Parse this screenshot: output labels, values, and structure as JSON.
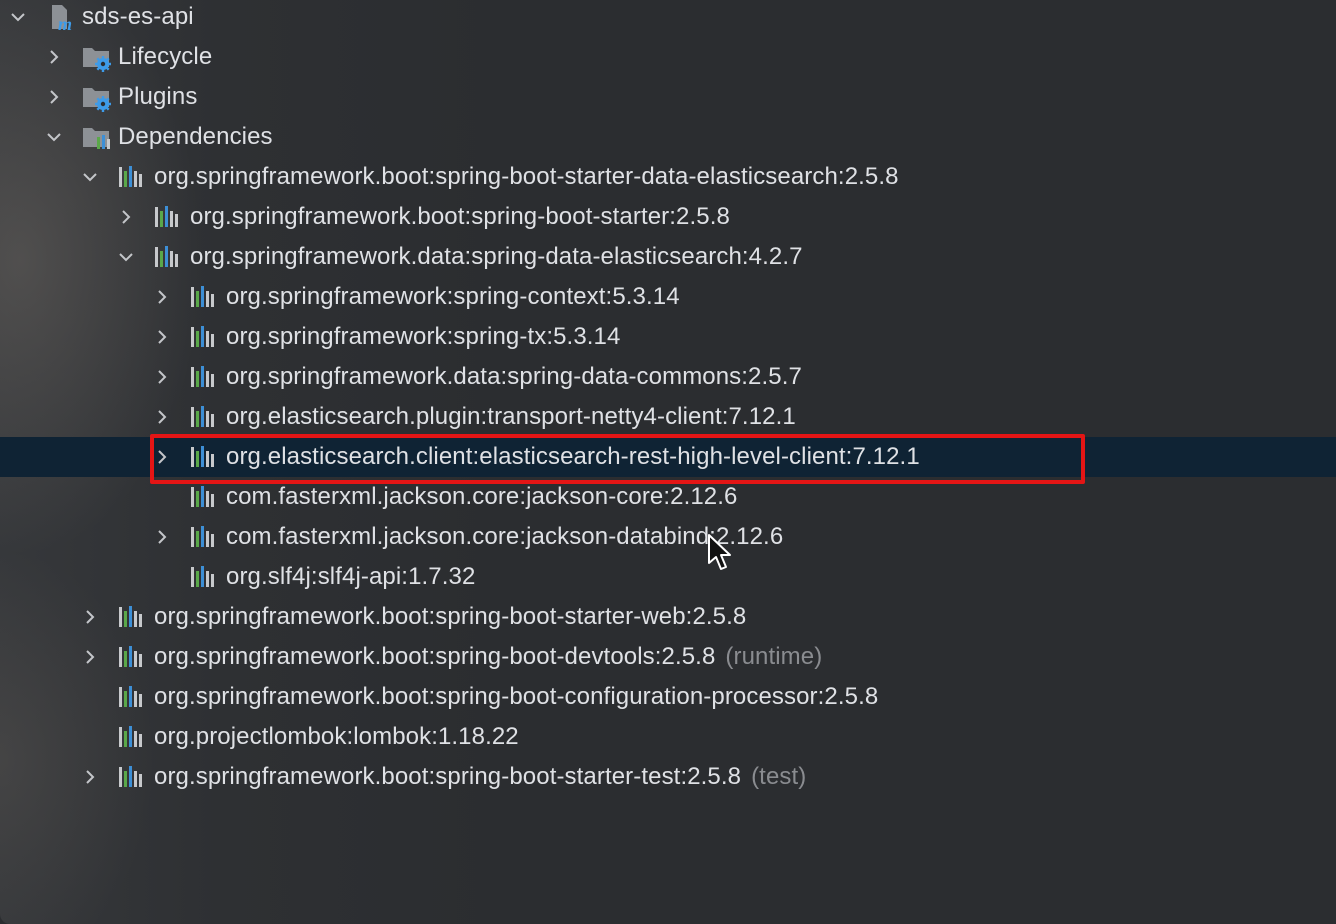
{
  "tree": {
    "project": {
      "name": "sds-es-api",
      "icon": "maven-module-icon"
    },
    "lifecycle": {
      "label": "Lifecycle",
      "icon": "folder-gear-icon"
    },
    "plugins": {
      "label": "Plugins",
      "icon": "folder-gear-icon"
    },
    "dependencies": {
      "label": "Dependencies",
      "icon": "folder-library-icon"
    },
    "items": [
      {
        "label": "org.springframework.boot:spring-boot-starter-data-elasticsearch:2.5.8",
        "scope": "",
        "depth": 1,
        "state": "expanded"
      },
      {
        "label": "org.springframework.boot:spring-boot-starter:2.5.8",
        "scope": "",
        "depth": 2,
        "state": "collapsed"
      },
      {
        "label": "org.springframework.data:spring-data-elasticsearch:4.2.7",
        "scope": "",
        "depth": 2,
        "state": "expanded"
      },
      {
        "label": "org.springframework:spring-context:5.3.14",
        "scope": "",
        "depth": 3,
        "state": "collapsed"
      },
      {
        "label": "org.springframework:spring-tx:5.3.14",
        "scope": "",
        "depth": 3,
        "state": "collapsed"
      },
      {
        "label": "org.springframework.data:spring-data-commons:2.5.7",
        "scope": "",
        "depth": 3,
        "state": "collapsed"
      },
      {
        "label": "org.elasticsearch.plugin:transport-netty4-client:7.12.1",
        "scope": "",
        "depth": 3,
        "state": "collapsed"
      },
      {
        "label": "org.elasticsearch.client:elasticsearch-rest-high-level-client:7.12.1",
        "scope": "",
        "depth": 3,
        "state": "collapsed",
        "selected": true,
        "highlighted": true
      },
      {
        "label": "com.fasterxml.jackson.core:jackson-core:2.12.6",
        "scope": "",
        "depth": 3,
        "state": "leaf"
      },
      {
        "label": "com.fasterxml.jackson.core:jackson-databind:2.12.6",
        "scope": "",
        "depth": 3,
        "state": "collapsed"
      },
      {
        "label": "org.slf4j:slf4j-api:1.7.32",
        "scope": "",
        "depth": 3,
        "state": "leaf"
      },
      {
        "label": "org.springframework.boot:spring-boot-starter-web:2.5.8",
        "scope": "",
        "depth": 1,
        "state": "collapsed"
      },
      {
        "label": "org.springframework.boot:spring-boot-devtools:2.5.8",
        "scope": "(runtime)",
        "depth": 1,
        "state": "collapsed"
      },
      {
        "label": "org.springframework.boot:spring-boot-configuration-processor:2.5.8",
        "scope": "",
        "depth": 1,
        "state": "leaf"
      },
      {
        "label": "org.projectlombok:lombok:1.18.22",
        "scope": "",
        "depth": 1,
        "state": "leaf"
      },
      {
        "label": "org.springframework.boot:spring-boot-starter-test:2.5.8",
        "scope": "(test)",
        "depth": 1,
        "state": "collapsed"
      }
    ]
  },
  "colors": {
    "background": "#2b2d30",
    "text": "#dfe1e5",
    "scope_text": "#8a8c90",
    "selection": "#0f2334",
    "highlight_border": "#e41515",
    "library_bar_green": "#5aa84a",
    "library_bar_blue": "#3d8fd6",
    "library_bar_gray": "#c7c9cc",
    "gear_blue": "#3d9be9"
  }
}
